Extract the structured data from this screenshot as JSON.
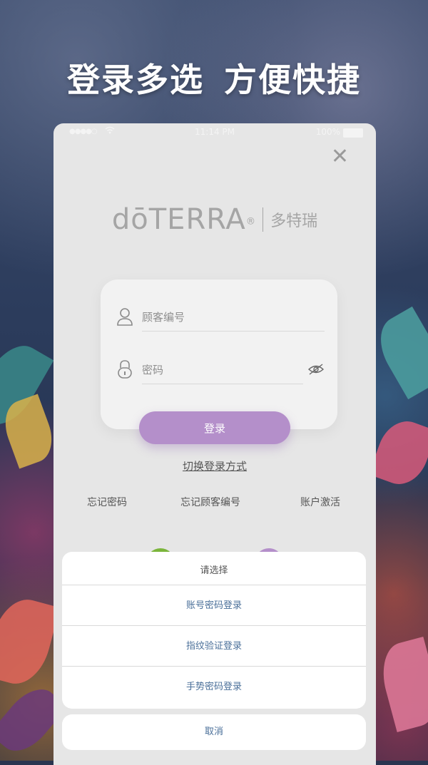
{
  "headline": {
    "part1": "登录多选",
    "part2": "方便快捷"
  },
  "status_bar": {
    "signal": "●●●●○",
    "time": "11:14 PM",
    "battery": "100%"
  },
  "close_label": "✕",
  "logo": {
    "brand": "dōTERRA",
    "registered": "®",
    "chinese": "多特瑞"
  },
  "form": {
    "customer_id_placeholder": "顾客编号",
    "password_placeholder": "密码",
    "login_label": "登录"
  },
  "switch_login_label": "切换登录方式",
  "links": {
    "forgot_password": "忘记密码",
    "forgot_customer_id": "忘记顾客编号",
    "activate_account": "账户激活"
  },
  "action_sheet": {
    "title": "请选择",
    "options": [
      "账号密码登录",
      "指纹验证登录",
      "手势密码登录"
    ],
    "cancel": "取消"
  },
  "colors": {
    "accent": "#b48fca",
    "sheet_option": "#4a6f99",
    "phone_bg": "#e6e6e6"
  }
}
